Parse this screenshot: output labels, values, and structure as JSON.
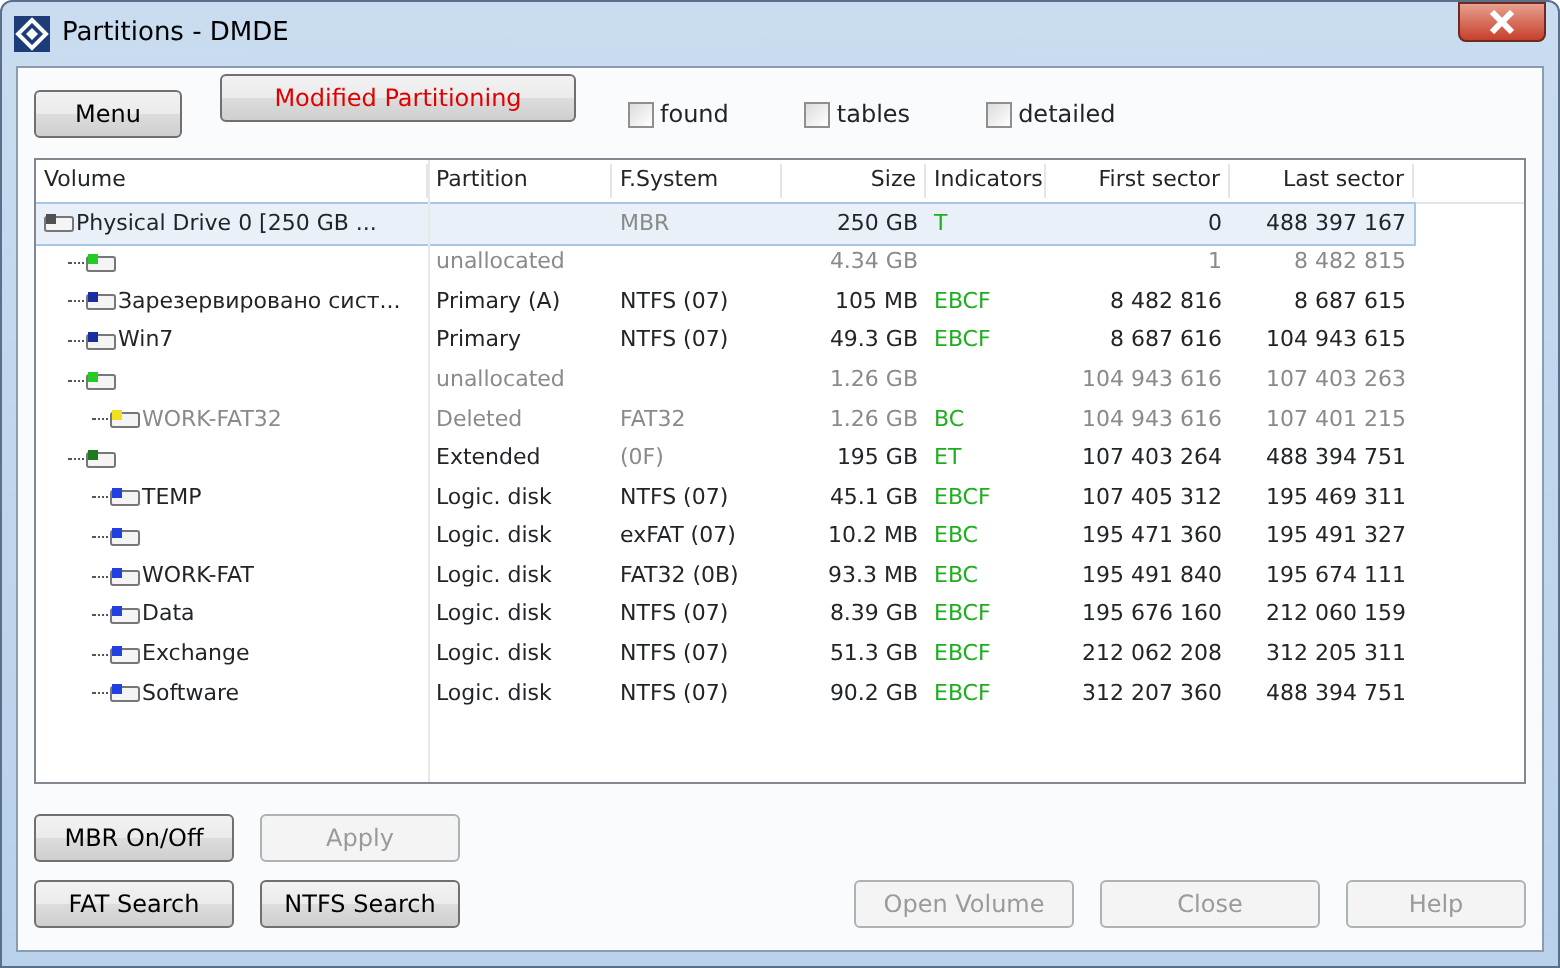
{
  "window": {
    "title": "Partitions - DMDE"
  },
  "toolbar": {
    "buttons": [
      {
        "label": "Menu",
        "kind": "normal"
      },
      {
        "label": "Modified Partitioning",
        "kind": "alert"
      }
    ],
    "checkboxes": [
      {
        "label": "found",
        "checked": false
      },
      {
        "label": "tables",
        "checked": false
      },
      {
        "label": "detailed",
        "checked": false
      }
    ]
  },
  "table": {
    "columns": [
      "Volume",
      "Partition",
      "F.System",
      "Size",
      "Indicators",
      "First sector",
      "Last sector"
    ],
    "rows": [
      {
        "volume": "Physical Drive 0 [250 GB ...",
        "fs": "MBR",
        "size": "250 GB",
        "indicators": "T",
        "first": "0",
        "last": "488 397 167",
        "selected": true,
        "greyed": false,
        "fs_greyed": true,
        "color": "#505050",
        "children": [
          {
            "partition": "unallocated",
            "size": "4.34 GB",
            "first": "1",
            "last": "8 482 815",
            "selected": false,
            "greyed": true,
            "color": "#22cc22"
          },
          {
            "volume": "Зарезервировано сист...",
            "partition": "Primary (A)",
            "fs": "NTFS (07)",
            "size": "105 MB",
            "indicators": "EBCF",
            "first": "8 482 816",
            "last": "8 687 615",
            "selected": false,
            "greyed": false,
            "fs_greyed": false,
            "color": "#1a2ea0"
          },
          {
            "volume": "Win7",
            "partition": "Primary",
            "fs": "NTFS (07)",
            "size": "49.3 GB",
            "indicators": "EBCF",
            "first": "8 687 616",
            "last": "104 943 615",
            "selected": false,
            "greyed": false,
            "fs_greyed": false,
            "color": "#1a2ea0"
          },
          {
            "partition": "unallocated",
            "size": "1.26 GB",
            "first": "104 943 616",
            "last": "107 403 263",
            "selected": false,
            "greyed": true,
            "color": "#22cc22",
            "children": [
              {
                "volume": "WORK-FAT32",
                "partition": "Deleted",
                "fs": "FAT32",
                "size": "1.26 GB",
                "indicators": "BC",
                "first": "104 943 616",
                "last": "107 401 215",
                "selected": false,
                "greyed": true,
                "fs_greyed": true,
                "color": "#f0e020"
              }
            ]
          },
          {
            "partition": "Extended",
            "fs": "(0F)",
            "size": "195 GB",
            "indicators": "ET",
            "first": "107 403 264",
            "last": "488 394 751",
            "selected": false,
            "greyed": false,
            "fs_greyed": true,
            "color": "#1e7a1e",
            "children": [
              {
                "volume": "TEMP",
                "partition": "Logic. disk",
                "fs": "NTFS (07)",
                "size": "45.1 GB",
                "indicators": "EBCF",
                "first": "107 405 312",
                "last": "195 469 311",
                "selected": false,
                "greyed": false,
                "fs_greyed": false,
                "color": "#2040e0"
              },
              {
                "partition": "Logic. disk",
                "fs": "exFAT (07)",
                "size": "10.2 MB",
                "indicators": "EBC",
                "first": "195 471 360",
                "last": "195 491 327",
                "selected": false,
                "greyed": false,
                "fs_greyed": false,
                "color": "#2040e0"
              },
              {
                "volume": "WORK-FAT",
                "partition": "Logic. disk",
                "fs": "FAT32 (0B)",
                "size": "93.3 MB",
                "indicators": "EBC",
                "first": "195 491 840",
                "last": "195 674 111",
                "selected": false,
                "greyed": false,
                "fs_greyed": false,
                "color": "#2040e0"
              },
              {
                "volume": "Data",
                "partition": "Logic. disk",
                "fs": "NTFS (07)",
                "size": "8.39 GB",
                "indicators": "EBCF",
                "first": "195 676 160",
                "last": "212 060 159",
                "selected": false,
                "greyed": false,
                "fs_greyed": false,
                "color": "#2040e0"
              },
              {
                "volume": "Exchange",
                "partition": "Logic. disk",
                "fs": "NTFS (07)",
                "size": "51.3 GB",
                "indicators": "EBCF",
                "first": "212 062 208",
                "last": "312 205 311",
                "selected": false,
                "greyed": false,
                "fs_greyed": false,
                "color": "#2040e0"
              },
              {
                "volume": "Software",
                "partition": "Logic. disk",
                "fs": "NTFS (07)",
                "size": "90.2 GB",
                "indicators": "EBCF",
                "first": "312 207 360",
                "last": "488 394 751",
                "selected": false,
                "greyed": false,
                "fs_greyed": false,
                "color": "#2040e0"
              }
            ]
          }
        ]
      }
    ]
  },
  "bottom_buttons": [
    {
      "label": "MBR On/Off",
      "disabled": false
    },
    {
      "label": "Apply",
      "disabled": true
    },
    {
      "label": "FAT Search",
      "disabled": false
    },
    {
      "label": "NTFS Search",
      "disabled": false
    },
    {
      "label": "Open Volume",
      "disabled": true
    },
    {
      "label": "Close",
      "disabled": true
    },
    {
      "label": "Help",
      "disabled": true
    }
  ]
}
